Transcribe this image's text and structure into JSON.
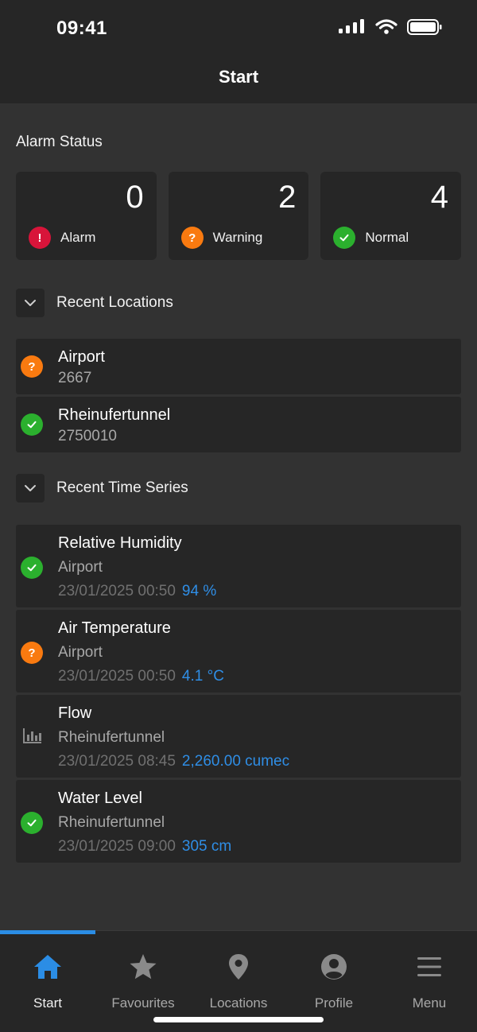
{
  "status_bar": {
    "time": "09:41"
  },
  "header": {
    "title": "Start"
  },
  "alarm_status": {
    "title": "Alarm Status",
    "cards": [
      {
        "count": "0",
        "label": "Alarm",
        "status": "alarm",
        "color": "#d8143a"
      },
      {
        "count": "2",
        "label": "Warning",
        "status": "warning",
        "color": "#f97a10"
      },
      {
        "count": "4",
        "label": "Normal",
        "status": "normal",
        "color": "#2bb02e"
      }
    ]
  },
  "recent_locations": {
    "title": "Recent Locations",
    "items": [
      {
        "name": "Airport",
        "id": "2667",
        "status": "warning"
      },
      {
        "name": "Rheinufertunnel",
        "id": "2750010",
        "status": "normal"
      }
    ]
  },
  "recent_time_series": {
    "title": "Recent Time Series",
    "items": [
      {
        "name": "Relative Humidity",
        "location": "Airport",
        "timestamp": "23/01/2025 00:50",
        "value": "94 %",
        "status": "normal"
      },
      {
        "name": "Air Temperature",
        "location": "Airport",
        "timestamp": "23/01/2025 00:50",
        "value": "4.1 °C",
        "status": "warning"
      },
      {
        "name": "Flow",
        "location": "Rheinufertunnel",
        "timestamp": "23/01/2025 08:45",
        "value": "2,260.00 cumec",
        "status": "none"
      },
      {
        "name": "Water Level",
        "location": "Rheinufertunnel",
        "timestamp": "23/01/2025 09:00",
        "value": "305 cm",
        "status": "normal"
      }
    ]
  },
  "bottom_nav": {
    "items": [
      {
        "label": "Start",
        "icon": "home-icon",
        "active": true
      },
      {
        "label": "Favourites",
        "icon": "star-icon",
        "active": false
      },
      {
        "label": "Locations",
        "icon": "location-pin-icon",
        "active": false
      },
      {
        "label": "Profile",
        "icon": "profile-icon",
        "active": false
      },
      {
        "label": "Menu",
        "icon": "menu-icon",
        "active": false
      }
    ]
  },
  "colors": {
    "accent": "#2b8de5",
    "value_text": "#2f8ee6"
  }
}
